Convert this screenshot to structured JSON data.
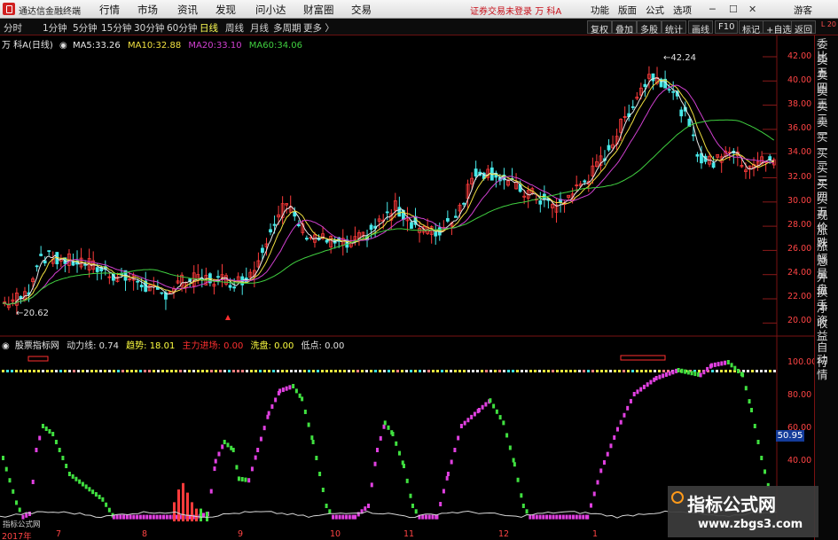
{
  "titlebar": {
    "app_title": "通达信金融终端",
    "menu": [
      "行情",
      "市场",
      "资讯",
      "发现",
      "问小达",
      "财富圈",
      "交易"
    ],
    "trade_status": "证券交易未登录",
    "stock": "万 科A",
    "right_menu": [
      "功能",
      "版面",
      "公式",
      "选项"
    ],
    "guest": "游客"
  },
  "toolbar": {
    "periods": [
      "分时",
      "1分钟",
      "5分钟",
      "15分钟",
      "30分钟",
      "60分钟",
      "日线",
      "周线",
      "月线",
      "多周期",
      "更多"
    ],
    "active_period": "日线",
    "right_tools": [
      "复权",
      "叠加",
      "多股",
      "统计",
      "画线",
      "F10",
      "标记",
      "+自选",
      "返回"
    ]
  },
  "main_chart": {
    "stock_name": "万 科A",
    "period": "(日线)",
    "ma": [
      {
        "label": "MA5:",
        "value": "33.26",
        "color": "#e8e8e8"
      },
      {
        "label": "MA10:",
        "value": "32.88",
        "color": "#f0e040"
      },
      {
        "label": "MA20:",
        "value": "33.10",
        "color": "#d040d0"
      },
      {
        "label": "MA60:",
        "value": "34.06",
        "color": "#40d040"
      }
    ],
    "high_label": "42.24",
    "low_label": "20.62",
    "y_ticks": [
      "42.00",
      "40.00",
      "38.00",
      "36.00",
      "34.00",
      "32.00",
      "30.00",
      "28.00",
      "26.00",
      "24.00",
      "22.00",
      "20.00"
    ]
  },
  "indicator": {
    "name": "股票指标网",
    "items": [
      {
        "label": "动力线:",
        "value": "0.74",
        "color": "#e0e0e0"
      },
      {
        "label": "趋势:",
        "value": "18.01",
        "color": "#ffff40"
      },
      {
        "label": "主力进场:",
        "value": "0.00",
        "color": "#ff3030"
      },
      {
        "label": "洗盘:",
        "value": "0.00",
        "color": "#ffff40"
      },
      {
        "label": "低点:",
        "value": "0.00",
        "color": "#e0e0e0"
      }
    ],
    "y_ticks": [
      "100.00",
      "80.00",
      "60.00",
      "40.00"
    ],
    "current_value": "50.95"
  },
  "date_axis": [
    "2017年",
    "7",
    "8",
    "9",
    "10",
    "11",
    "12",
    "1"
  ],
  "right_panel": [
    "委比",
    "卖五",
    "卖四",
    "卖三",
    "卖二",
    "卖一",
    "买一",
    "买二",
    "买三",
    "买四",
    "买五",
    "现价",
    "涨跌",
    "涨幅",
    "总量",
    "外盘",
    "换手",
    "净资",
    "收益"
  ],
  "right_panel_bottom": [
    "自动",
    "行情"
  ],
  "right_panel_badge": "L 20",
  "watermark": {
    "text": "指标公式网",
    "url": "www.zbgs3.com"
  },
  "source_tag": "指标公式网",
  "colors": {
    "up": "#ff3b3b",
    "down": "#48e8e8",
    "ma5": "#e8e8e8",
    "ma10": "#f0e040",
    "ma20": "#d040d0",
    "ma60": "#40d040",
    "axis": "#ff4444",
    "ind_up": "#e040e0",
    "ind_down": "#40e040"
  }
}
